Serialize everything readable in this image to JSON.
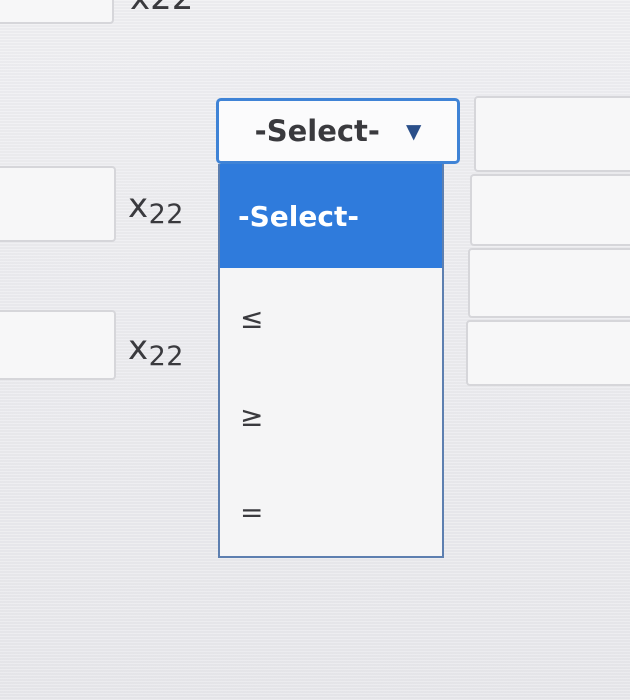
{
  "variables": {
    "top_partial": "x22",
    "row1_label": "x",
    "row1_sub": "22",
    "row2_label": "x",
    "row2_sub": "22"
  },
  "select": {
    "selected_value": "-Select-",
    "caret_icon": "triangle-down-icon",
    "options": [
      "-Select-",
      "≤",
      "≥",
      "="
    ],
    "highlighted_index": 0
  },
  "colors": {
    "select_border": "#3f83d6",
    "highlight": "#2f7bdc",
    "list_border": "#5d7fb0"
  }
}
